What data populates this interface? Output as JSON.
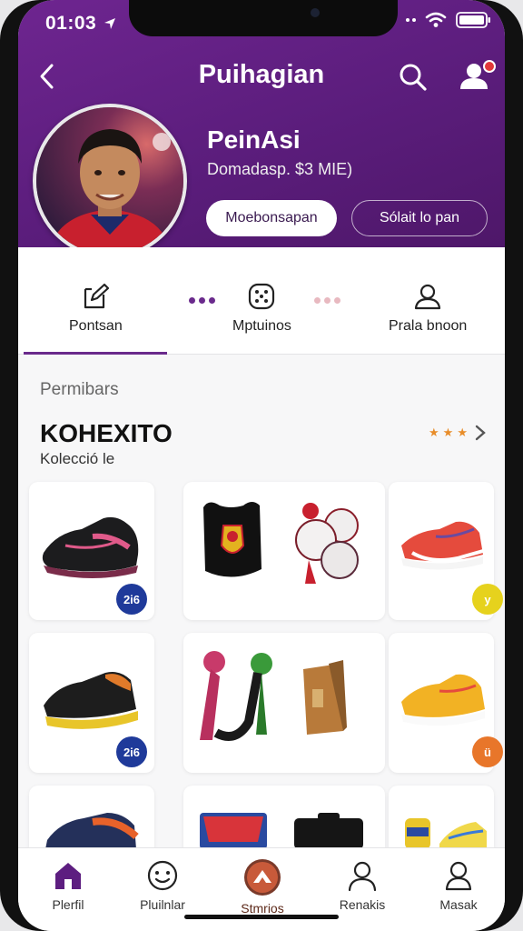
{
  "status_bar": {
    "time": "01:03"
  },
  "topbar": {
    "title": "Puihagian"
  },
  "profile": {
    "name": "PeinAsi",
    "subtitle": "Domadasp. $3 MIE)",
    "primary_button": "Moebonsapan",
    "secondary_button": "Sólait lo pan"
  },
  "tabs": [
    {
      "label": "Pontsan",
      "icon": "edit-document-icon",
      "active": true
    },
    {
      "label": "Mptuinos",
      "icon": "dice-icon",
      "active": false
    },
    {
      "label": "Prala bnoon",
      "icon": "user-outline-icon",
      "active": false
    }
  ],
  "section": {
    "label": "Permibars",
    "title": "KOHEXITO",
    "subtitle": "Kolecció le"
  },
  "products": [
    {
      "name": "black-pink-sneaker",
      "price": "2i6",
      "badge_color": "#1f3a9a"
    },
    {
      "name": "crest-drawstring-bag",
      "price": "",
      "badge_color": ""
    },
    {
      "name": "sports-balls-set",
      "price": "",
      "badge_color": ""
    },
    {
      "name": "red-running-shoes",
      "price": "y",
      "badge_color": "#e6d21d"
    },
    {
      "name": "black-yellow-sneaker",
      "price": "2i6",
      "badge_color": "#1f3a9a"
    },
    {
      "name": "ribbon-rosettes",
      "price": "",
      "badge_color": ""
    },
    {
      "name": "wooden-box",
      "price": "",
      "badge_color": ""
    },
    {
      "name": "yellow-running-shoes",
      "price": "ü",
      "badge_color": "#e8762a"
    },
    {
      "name": "blue-orange-sneaker",
      "price": "",
      "badge_color": ""
    },
    {
      "name": "printed-bag",
      "price": "",
      "badge_color": ""
    },
    {
      "name": "black-case",
      "price": "",
      "badge_color": ""
    },
    {
      "name": "accessories",
      "price": "",
      "badge_color": ""
    }
  ],
  "bottom_nav": [
    {
      "label": "Plerfil",
      "icon": "home-icon",
      "active": true
    },
    {
      "label": "Pluilnlar",
      "icon": "smile-icon",
      "active": false
    },
    {
      "label": "Stmrios",
      "icon": "arrow-badge-icon",
      "active": false
    },
    {
      "label": "Renakis",
      "icon": "person-icon",
      "active": false
    },
    {
      "label": "Masak",
      "icon": "person-outline-icon",
      "active": false
    }
  ],
  "colors": {
    "brand_purple": "#5d1e80",
    "accent_orange": "#e88d2a",
    "tab_indicator": "#6a2a8c"
  }
}
